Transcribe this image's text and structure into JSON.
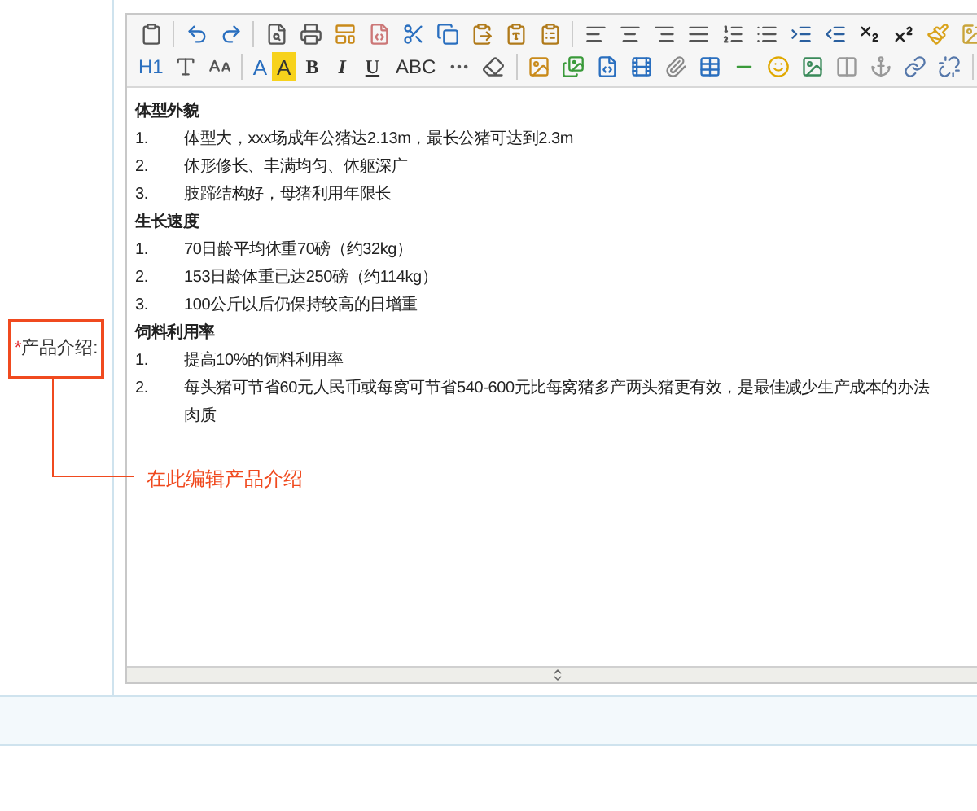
{
  "field": {
    "required_mark": "*",
    "label": "产品介绍:"
  },
  "callout": {
    "text": "在此编辑产品介绍"
  },
  "toolbar": {
    "heading": "H1",
    "font_color": "A",
    "highlight": "A",
    "bold": "B",
    "italic": "I",
    "underline": "U",
    "strikethrough": "ABC"
  },
  "content": [
    {
      "title": "体型外貌",
      "items": [
        {
          "number": "1.",
          "lines": [
            "体型大，xxx场成年公猪达2.13m，最长公猪可达到2.3m"
          ]
        },
        {
          "number": "2.",
          "lines": [
            "体形修长、丰满均匀、体躯深广"
          ]
        },
        {
          "number": "3.",
          "lines": [
            "肢蹄结构好，母猪利用年限长"
          ]
        }
      ]
    },
    {
      "title": "生长速度",
      "items": [
        {
          "number": "1.",
          "lines": [
            "70日龄平均体重70磅（约32kg）"
          ]
        },
        {
          "number": "2.",
          "lines": [
            "153日龄体重已达250磅（约114kg）"
          ]
        },
        {
          "number": "3.",
          "lines": [
            "100公斤以后仍保持较高的日增重"
          ]
        }
      ]
    },
    {
      "title": "饲料利用率",
      "items": [
        {
          "number": "1.",
          "lines": [
            "提高10%的饲料利用率"
          ]
        },
        {
          "number": "2.",
          "lines": [
            "每头猪可节省60元人民币或每窝可节省540-600元比每窝猪多产两头猪更有效，是最佳减少生产成本的办法",
            "肉质"
          ]
        }
      ]
    }
  ]
}
